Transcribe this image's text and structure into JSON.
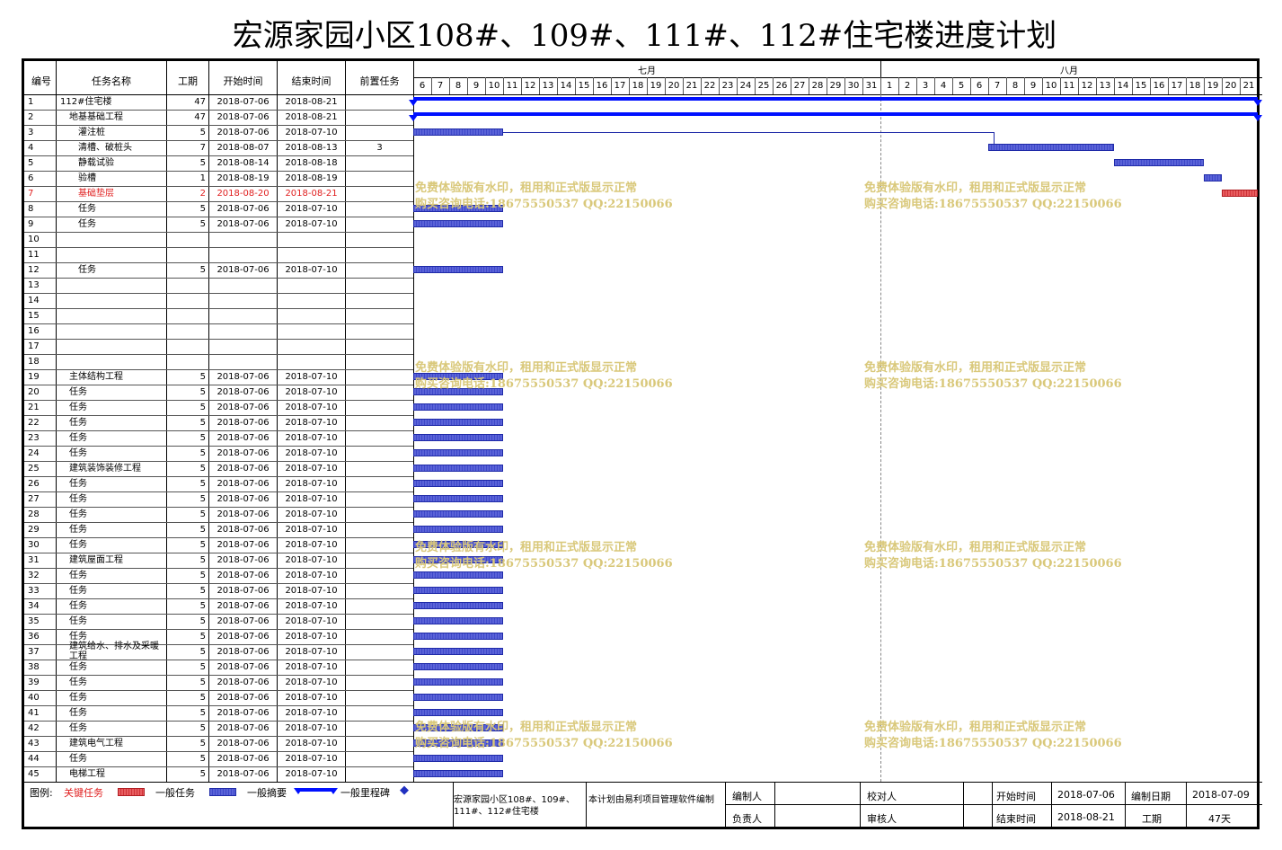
{
  "title": "宏源家园小区108#、109#、111#、112#住宅楼进度计划",
  "columns": {
    "id": "编号",
    "name": "任务名称",
    "duration": "工期",
    "start": "开始时间",
    "end": "结束时间",
    "pred": "前置任务"
  },
  "months": [
    {
      "label": "七月",
      "days": [
        6,
        7,
        8,
        9,
        10,
        11,
        12,
        13,
        14,
        15,
        16,
        17,
        18,
        19,
        20,
        21,
        22,
        23,
        24,
        25,
        26,
        27,
        28,
        29,
        30,
        31
      ]
    },
    {
      "label": "八月",
      "days": [
        1,
        2,
        3,
        4,
        5,
        6,
        7,
        8,
        9,
        10,
        11,
        12,
        13,
        14,
        15,
        16,
        17,
        18,
        19,
        20,
        21
      ]
    }
  ],
  "rows": [
    {
      "id": "1",
      "name": "112#住宅楼",
      "indent": 0,
      "dur": "47",
      "start": "2018-07-06",
      "end": "2018-08-21",
      "pred": "",
      "kind": "summary",
      "s": 0,
      "e": 47
    },
    {
      "id": "2",
      "name": "地基基础工程",
      "indent": 1,
      "dur": "47",
      "start": "2018-07-06",
      "end": "2018-08-21",
      "pred": "",
      "kind": "summary",
      "s": 0,
      "e": 47
    },
    {
      "id": "3",
      "name": "灌注桩",
      "indent": 2,
      "dur": "5",
      "start": "2018-07-06",
      "end": "2018-07-10",
      "pred": "",
      "kind": "normal",
      "s": 0,
      "e": 5
    },
    {
      "id": "4",
      "name": "清槽、破桩头",
      "indent": 2,
      "dur": "7",
      "start": "2018-08-07",
      "end": "2018-08-13",
      "pred": "3",
      "kind": "normal",
      "s": 32,
      "e": 39
    },
    {
      "id": "5",
      "name": "静载试验",
      "indent": 2,
      "dur": "5",
      "start": "2018-08-14",
      "end": "2018-08-18",
      "pred": "",
      "kind": "normal",
      "s": 39,
      "e": 44
    },
    {
      "id": "6",
      "name": "验槽",
      "indent": 2,
      "dur": "1",
      "start": "2018-08-19",
      "end": "2018-08-19",
      "pred": "",
      "kind": "normal",
      "s": 44,
      "e": 45
    },
    {
      "id": "7",
      "name": "基础垫层",
      "indent": 2,
      "dur": "2",
      "start": "2018-08-20",
      "end": "2018-08-21",
      "pred": "",
      "kind": "critical",
      "s": 45,
      "e": 47
    },
    {
      "id": "8",
      "name": "任务",
      "indent": 2,
      "dur": "5",
      "start": "2018-07-06",
      "end": "2018-07-10",
      "pred": "",
      "kind": "normal",
      "s": 0,
      "e": 5
    },
    {
      "id": "9",
      "name": "任务",
      "indent": 2,
      "dur": "5",
      "start": "2018-07-06",
      "end": "2018-07-10",
      "pred": "",
      "kind": "normal",
      "s": 0,
      "e": 5
    },
    {
      "id": "10",
      "name": "",
      "indent": 0,
      "dur": "",
      "start": "",
      "end": "",
      "pred": "",
      "kind": "none"
    },
    {
      "id": "11",
      "name": "",
      "indent": 0,
      "dur": "",
      "start": "",
      "end": "",
      "pred": "",
      "kind": "none"
    },
    {
      "id": "12",
      "name": "任务",
      "indent": 2,
      "dur": "5",
      "start": "2018-07-06",
      "end": "2018-07-10",
      "pred": "",
      "kind": "normal",
      "s": 0,
      "e": 5
    },
    {
      "id": "13",
      "name": "",
      "indent": 0,
      "dur": "",
      "start": "",
      "end": "",
      "pred": "",
      "kind": "none"
    },
    {
      "id": "14",
      "name": "",
      "indent": 0,
      "dur": "",
      "start": "",
      "end": "",
      "pred": "",
      "kind": "none"
    },
    {
      "id": "15",
      "name": "",
      "indent": 0,
      "dur": "",
      "start": "",
      "end": "",
      "pred": "",
      "kind": "none"
    },
    {
      "id": "16",
      "name": "",
      "indent": 0,
      "dur": "",
      "start": "",
      "end": "",
      "pred": "",
      "kind": "none"
    },
    {
      "id": "17",
      "name": "",
      "indent": 0,
      "dur": "",
      "start": "",
      "end": "",
      "pred": "",
      "kind": "none"
    },
    {
      "id": "18",
      "name": "",
      "indent": 0,
      "dur": "",
      "start": "",
      "end": "",
      "pred": "",
      "kind": "none"
    },
    {
      "id": "19",
      "name": "主体结构工程",
      "indent": 1,
      "dur": "5",
      "start": "2018-07-06",
      "end": "2018-07-10",
      "pred": "",
      "kind": "normal",
      "s": 0,
      "e": 5
    },
    {
      "id": "20",
      "name": "任务",
      "indent": 1,
      "dur": "5",
      "start": "2018-07-06",
      "end": "2018-07-10",
      "pred": "",
      "kind": "normal",
      "s": 0,
      "e": 5
    },
    {
      "id": "21",
      "name": "任务",
      "indent": 1,
      "dur": "5",
      "start": "2018-07-06",
      "end": "2018-07-10",
      "pred": "",
      "kind": "normal",
      "s": 0,
      "e": 5
    },
    {
      "id": "22",
      "name": "任务",
      "indent": 1,
      "dur": "5",
      "start": "2018-07-06",
      "end": "2018-07-10",
      "pred": "",
      "kind": "normal",
      "s": 0,
      "e": 5
    },
    {
      "id": "23",
      "name": "任务",
      "indent": 1,
      "dur": "5",
      "start": "2018-07-06",
      "end": "2018-07-10",
      "pred": "",
      "kind": "normal",
      "s": 0,
      "e": 5
    },
    {
      "id": "24",
      "name": "任务",
      "indent": 1,
      "dur": "5",
      "start": "2018-07-06",
      "end": "2018-07-10",
      "pred": "",
      "kind": "normal",
      "s": 0,
      "e": 5
    },
    {
      "id": "25",
      "name": "建筑装饰装修工程",
      "indent": 1,
      "dur": "5",
      "start": "2018-07-06",
      "end": "2018-07-10",
      "pred": "",
      "kind": "normal",
      "s": 0,
      "e": 5
    },
    {
      "id": "26",
      "name": "任务",
      "indent": 1,
      "dur": "5",
      "start": "2018-07-06",
      "end": "2018-07-10",
      "pred": "",
      "kind": "normal",
      "s": 0,
      "e": 5
    },
    {
      "id": "27",
      "name": "任务",
      "indent": 1,
      "dur": "5",
      "start": "2018-07-06",
      "end": "2018-07-10",
      "pred": "",
      "kind": "normal",
      "s": 0,
      "e": 5
    },
    {
      "id": "28",
      "name": "任务",
      "indent": 1,
      "dur": "5",
      "start": "2018-07-06",
      "end": "2018-07-10",
      "pred": "",
      "kind": "normal",
      "s": 0,
      "e": 5
    },
    {
      "id": "29",
      "name": "任务",
      "indent": 1,
      "dur": "5",
      "start": "2018-07-06",
      "end": "2018-07-10",
      "pred": "",
      "kind": "normal",
      "s": 0,
      "e": 5
    },
    {
      "id": "30",
      "name": "任务",
      "indent": 1,
      "dur": "5",
      "start": "2018-07-06",
      "end": "2018-07-10",
      "pred": "",
      "kind": "normal",
      "s": 0,
      "e": 5
    },
    {
      "id": "31",
      "name": "建筑屋面工程",
      "indent": 1,
      "dur": "5",
      "start": "2018-07-06",
      "end": "2018-07-10",
      "pred": "",
      "kind": "normal",
      "s": 0,
      "e": 5
    },
    {
      "id": "32",
      "name": "任务",
      "indent": 1,
      "dur": "5",
      "start": "2018-07-06",
      "end": "2018-07-10",
      "pred": "",
      "kind": "normal",
      "s": 0,
      "e": 5
    },
    {
      "id": "33",
      "name": "任务",
      "indent": 1,
      "dur": "5",
      "start": "2018-07-06",
      "end": "2018-07-10",
      "pred": "",
      "kind": "normal",
      "s": 0,
      "e": 5
    },
    {
      "id": "34",
      "name": "任务",
      "indent": 1,
      "dur": "5",
      "start": "2018-07-06",
      "end": "2018-07-10",
      "pred": "",
      "kind": "normal",
      "s": 0,
      "e": 5
    },
    {
      "id": "35",
      "name": "任务",
      "indent": 1,
      "dur": "5",
      "start": "2018-07-06",
      "end": "2018-07-10",
      "pred": "",
      "kind": "normal",
      "s": 0,
      "e": 5
    },
    {
      "id": "36",
      "name": "任务",
      "indent": 1,
      "dur": "5",
      "start": "2018-07-06",
      "end": "2018-07-10",
      "pred": "",
      "kind": "normal",
      "s": 0,
      "e": 5
    },
    {
      "id": "37",
      "name": "建筑给水、排水及采暖工程",
      "indent": 1,
      "dur": "5",
      "start": "2018-07-06",
      "end": "2018-07-10",
      "pred": "",
      "kind": "normal",
      "s": 0,
      "e": 5
    },
    {
      "id": "38",
      "name": "任务",
      "indent": 1,
      "dur": "5",
      "start": "2018-07-06",
      "end": "2018-07-10",
      "pred": "",
      "kind": "normal",
      "s": 0,
      "e": 5
    },
    {
      "id": "39",
      "name": "任务",
      "indent": 1,
      "dur": "5",
      "start": "2018-07-06",
      "end": "2018-07-10",
      "pred": "",
      "kind": "normal",
      "s": 0,
      "e": 5
    },
    {
      "id": "40",
      "name": "任务",
      "indent": 1,
      "dur": "5",
      "start": "2018-07-06",
      "end": "2018-07-10",
      "pred": "",
      "kind": "normal",
      "s": 0,
      "e": 5
    },
    {
      "id": "41",
      "name": "任务",
      "indent": 1,
      "dur": "5",
      "start": "2018-07-06",
      "end": "2018-07-10",
      "pred": "",
      "kind": "normal",
      "s": 0,
      "e": 5
    },
    {
      "id": "42",
      "name": "任务",
      "indent": 1,
      "dur": "5",
      "start": "2018-07-06",
      "end": "2018-07-10",
      "pred": "",
      "kind": "normal",
      "s": 0,
      "e": 5
    },
    {
      "id": "43",
      "name": "建筑电气工程",
      "indent": 1,
      "dur": "5",
      "start": "2018-07-06",
      "end": "2018-07-10",
      "pred": "",
      "kind": "normal",
      "s": 0,
      "e": 5
    },
    {
      "id": "44",
      "name": "任务",
      "indent": 1,
      "dur": "5",
      "start": "2018-07-06",
      "end": "2018-07-10",
      "pred": "",
      "kind": "normal",
      "s": 0,
      "e": 5
    },
    {
      "id": "45",
      "name": "电梯工程",
      "indent": 1,
      "dur": "5",
      "start": "2018-07-06",
      "end": "2018-07-10",
      "pred": "",
      "kind": "normal",
      "s": 0,
      "e": 5
    }
  ],
  "watermark": {
    "line1": "免费体验版有水印，租用和正式版显示正常",
    "line2": "购买咨询电话:18675550537 QQ:22150066"
  },
  "legend": {
    "label": "图例:",
    "critical": "关键任务",
    "normal": "一般任务",
    "summary": "一般摘要",
    "milestone": "一般里程碑"
  },
  "footer": {
    "project": "宏源家园小区108#、109#、111#、112#住宅楼",
    "note": "本计划由易利项目管理软件编制",
    "compiler_label": "编制人",
    "checker_label": "校对人",
    "owner_label": "负责人",
    "reviewer_label": "审核人",
    "start_label": "开始时间",
    "start_value": "2018-07-06",
    "date_label": "编制日期",
    "date_value": "2018-07-09",
    "end_label": "结束时间",
    "end_value": "2018-08-21",
    "dur_label": "工期",
    "dur_value": "47天"
  },
  "colors": {
    "summary": "#0010ff",
    "normal": "#4d57d6",
    "critical": "#e0474b",
    "watermark": "#d9c87a"
  }
}
